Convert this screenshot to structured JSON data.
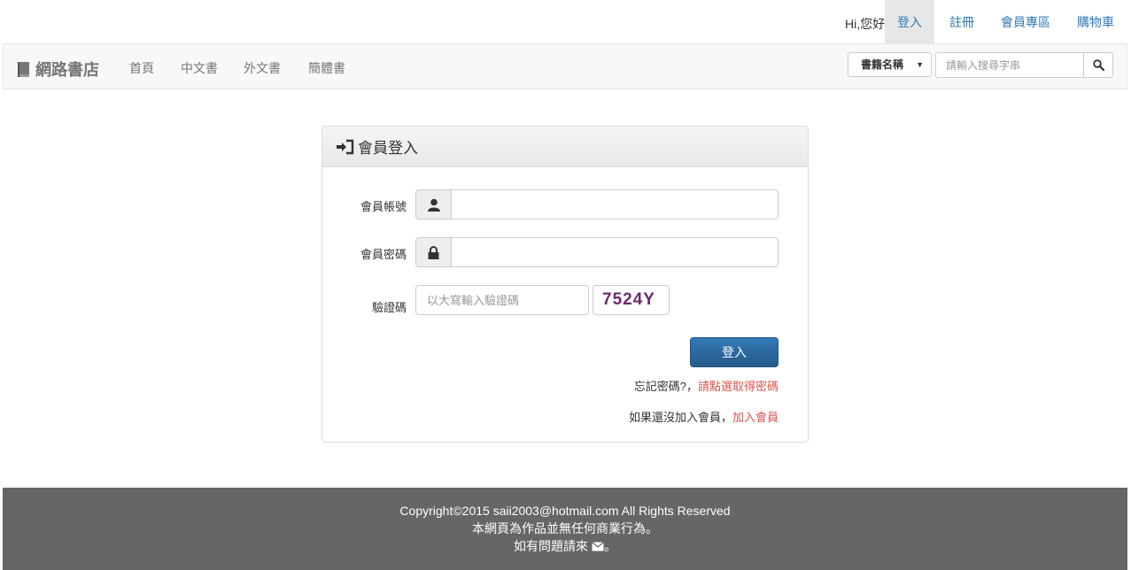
{
  "topbar": {
    "greeting": "Hi,您好",
    "links": [
      "登入",
      "註冊",
      "會員專區",
      "購物車"
    ]
  },
  "navbar": {
    "brand": "網路書店",
    "items": [
      "首頁",
      "中文書",
      "外文書",
      "簡體書"
    ],
    "search_select": "書籍名稱",
    "search_placeholder": "請輸入搜尋字串"
  },
  "panel": {
    "title": "會員登入",
    "account_label": "會員帳號",
    "password_label": "會員密碼",
    "captcha_label": "驗證碼",
    "captcha_placeholder": "以大寫輸入驗證碼",
    "captcha_code": "7524Y",
    "login_button": "登入",
    "forgot_text": "忘記密碼?，",
    "forgot_link": "請點選取得密碼",
    "join_text": "如果還沒加入會員，",
    "join_link": "加入會員"
  },
  "footer": {
    "line1": "Copyright©2015 saii2003@hotmail.com All Rights Reserved",
    "line2": "本網頁為作品並無任何商業行為。",
    "line3_prefix": "如有問題請來",
    "line3_suffix": "。"
  },
  "colors": {
    "link": "#337ab7",
    "danger_link": "#d9534f",
    "primary_button": "#337ab7",
    "footer_bg": "#666666",
    "captcha_text": "#6b2a6d"
  },
  "icons": {
    "brand": "book-icon",
    "search": "search-icon",
    "login_heading": "sign-in-icon",
    "account": "user-icon",
    "password": "lock-icon",
    "contact": "envelope-icon"
  }
}
